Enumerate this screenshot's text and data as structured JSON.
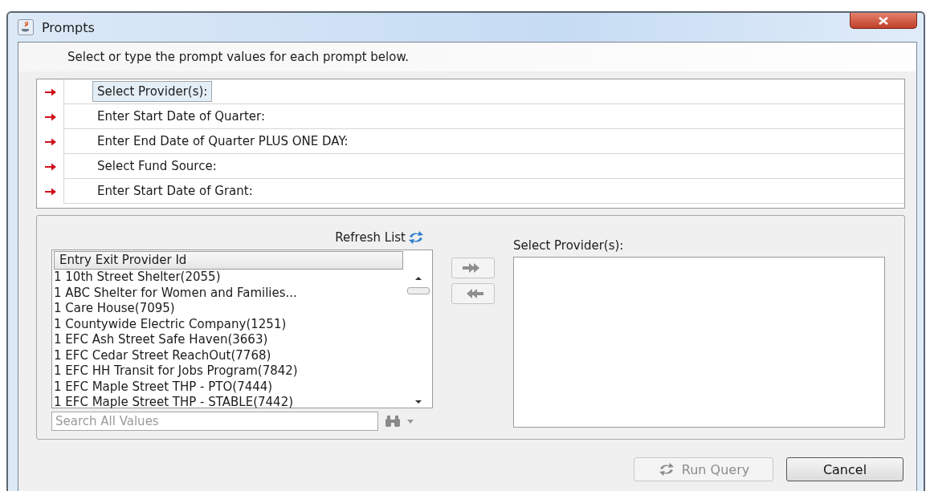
{
  "window": {
    "title": "Prompts"
  },
  "instruction": "Select or type the prompt values for each prompt below.",
  "prompts": [
    {
      "label": "Select Provider(s):",
      "required": true,
      "selected": true
    },
    {
      "label": "Enter Start Date of Quarter:",
      "required": true,
      "selected": false
    },
    {
      "label": "Enter End Date of Quarter PLUS ONE DAY:",
      "required": true,
      "selected": false
    },
    {
      "label": "Select Fund Source:",
      "required": true,
      "selected": false
    },
    {
      "label": "Enter Start Date of Grant:",
      "required": true,
      "selected": false
    }
  ],
  "refresh_label": "Refresh List",
  "available": {
    "column": "Entry Exit Provider Id",
    "items": [
      "1 10th Street Shelter(2055)",
      "1 ABC Shelter for Women and Families...",
      "1 Care House(7095)",
      "1 Countywide Electric Company(1251)",
      "1 EFC Ash Street Safe Haven(3663)",
      "1 EFC Cedar Street ReachOut(7768)",
      "1 EFC HH Transit for Jobs Program(7842)",
      "1 EFC Maple Street THP - PTO(7444)",
      "1 EFC Maple Street THP - STABLE(7442)"
    ]
  },
  "search": {
    "placeholder": "Search All Values"
  },
  "selected_list": {
    "title": "Select Provider(s):"
  },
  "buttons": [
    {
      "label": "Run Query",
      "kind": "run",
      "disabled": true
    },
    {
      "label": "Cancel",
      "kind": "cancel",
      "disabled": false
    }
  ]
}
